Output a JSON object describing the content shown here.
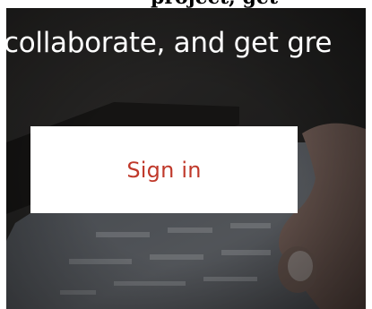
{
  "top_strip": {
    "text": "project, get"
  },
  "hero": {
    "headline": "collaborate, and get gre",
    "signin_button": {
      "label": "Sign in"
    }
  },
  "colors": {
    "signin_label": "#c0392b",
    "hero_overlay": "#2d2b2a",
    "button_bg": "#ffffff"
  }
}
